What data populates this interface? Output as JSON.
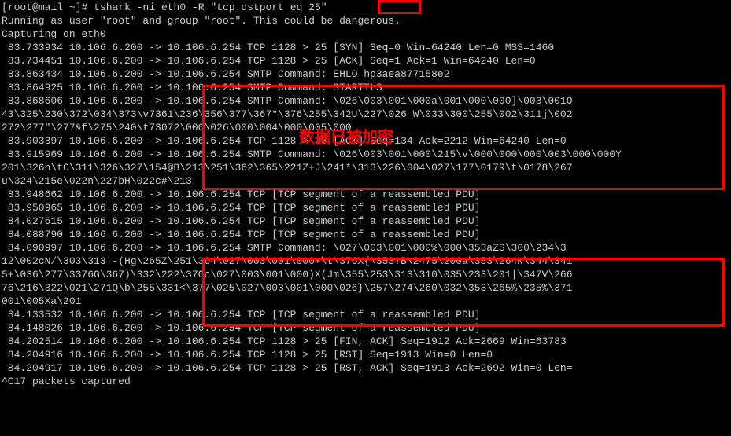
{
  "prompt": {
    "user": "root",
    "host": "mail",
    "path": "~",
    "symbol": "#",
    "command": "tshark -ni eth0 -R \"tcp.dstport eq 25\""
  },
  "warning": "Running as user \"root\" and group \"root\". This could be dangerous.",
  "capture_msg": "Capturing on eth0",
  "annotation": "数据已被加密",
  "lines": [
    " 83.733934 10.106.6.200 -> 10.106.6.254 TCP 1128 > 25 [SYN] Seq=0 Win=64240 Len=0 MSS=1460",
    " 83.734451 10.106.6.200 -> 10.106.6.254 TCP 1128 > 25 [ACK] Seq=1 Ack=1 Win=64240 Len=0",
    " 83.863434 10.106.6.200 -> 10.106.6.254 SMTP Command: EHLO hp3aea877158e2",
    " 83.864925 10.106.6.200 -> 10.106.6.254 SMTP Command: STARTTLS",
    " 83.868606 10.106.6.200 -> 10.106.6.254 SMTP Command: \\026\\003\\001\\000a\\001\\000\\000]\\003\\001O",
    "43\\325\\230\\372\\034\\373\\v7361\\236\\356\\377\\367*\\376\\255\\342U\\227\\026 W\\033\\300\\255\\002\\311j\\002",
    "272\\277\"\\277&f\\275\\240\\t73072\\000\\026\\000\\004\\000\\005\\000",
    " 83.903397 10.106.6.200 -> 10.106.6.254 TCP 1128 > 25 [ACK] Seq=134 Ack=2212 Win=64240 Len=0",
    " 83.915969 10.106.6.200 -> 10.106.6.254 SMTP Command: \\026\\003\\001\\000\\215\\v\\000\\000\\000\\003\\000\\000Y",
    "201\\326n\\tC\\311\\326\\327\\154@B\\213\\251\\362\\365\\221Z+J\\241*\\313\\226\\004\\027\\177\\017R\\t\\0178\\267",
    "u\\324\\215e\\022n\\227bH\\022c#\\213",
    " 83.948662 10.106.6.200 -> 10.106.6.254 TCP [TCP segment of a reassembled PDU]",
    " 83.950965 10.106.6.200 -> 10.106.6.254 TCP [TCP segment of a reassembled PDU]",
    " 84.027615 10.106.6.200 -> 10.106.6.254 TCP [TCP segment of a reassembled PDU]",
    " 84.088790 10.106.6.200 -> 10.106.6.254 TCP [TCP segment of a reassembled PDU]",
    " 84.090997 10.106.6.200 -> 10.106.6.254 SMTP Command: \\027\\003\\001\\000%\\000\\353aZS\\300\\234\\3",
    "12\\002cN/\\303\\313!-(Hg\\265Z\\251\\364\\027\\003\\001\\000+\\t\\376X{\\353!B\\2475\\200a\\353\\264N\\344\\341",
    "5+\\036\\277\\3376G\\367)\\332\\222\\370c\\027\\003\\001\\000)X(Jm\\355\\253\\313\\310\\035\\233\\201|\\347V\\266",
    "76\\216\\322\\021\\271Q\\b\\255\\331<\\377\\025\\027\\003\\001\\000\\026}\\257\\274\\260\\032\\353\\265%\\235%\\371",
    "001\\005Xa\\201",
    " 84.133532 10.106.6.200 -> 10.106.6.254 TCP [TCP segment of a reassembled PDU]",
    " 84.148026 10.106.6.200 -> 10.106.6.254 TCP [TCP segment of a reassembled PDU]",
    " 84.202514 10.106.6.200 -> 10.106.6.254 TCP 1128 > 25 [FIN, ACK] Seq=1912 Ack=2669 Win=63783",
    " 84.204916 10.106.6.200 -> 10.106.6.254 TCP 1128 > 25 [RST] Seq=1913 Win=0 Len=0",
    " 84.204917 10.106.6.200 -> 10.106.6.254 TCP 1128 > 25 [RST, ACK] Seq=1913 Ack=2692 Win=0 Len=",
    "^C17 packets captured"
  ]
}
